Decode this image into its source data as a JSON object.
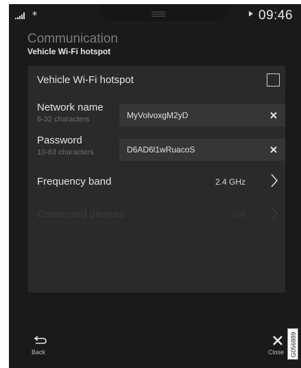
{
  "status_bar": {
    "bluetooth_glyph": "∗",
    "clock": "09:46",
    "icons": [
      "signal-icon",
      "bluetooth-icon",
      "handle-icon",
      "play-icon"
    ]
  },
  "header": {
    "title": "Communication",
    "subtitle": "Vehicle Wi-Fi hotspot"
  },
  "settings": {
    "hotspot": {
      "label": "Vehicle Wi-Fi hotspot",
      "checked": false
    },
    "network_name": {
      "label": "Network name",
      "hint": "6-32 characters",
      "value": "MyVolvoxgM2yD"
    },
    "password": {
      "label": "Password",
      "hint": "10-63 characters",
      "value": "D6AD6l1wRuacoS"
    },
    "frequency_band": {
      "label": "Frequency band",
      "value": "2.4 GHz"
    },
    "connected_devices": {
      "label": "Connected devices",
      "value": "0/8",
      "enabled": false
    }
  },
  "footer": {
    "back_label": "Back",
    "close_label": "Close"
  },
  "figure_code": "G056889",
  "colors": {
    "screen_bg": "#1a1a1a",
    "panel_bg": "#2a2a2a",
    "field_bg": "#363636",
    "text_primary": "#e4e4e4",
    "text_muted": "#6d6d6d",
    "text_disabled": "#3c3c3c"
  }
}
